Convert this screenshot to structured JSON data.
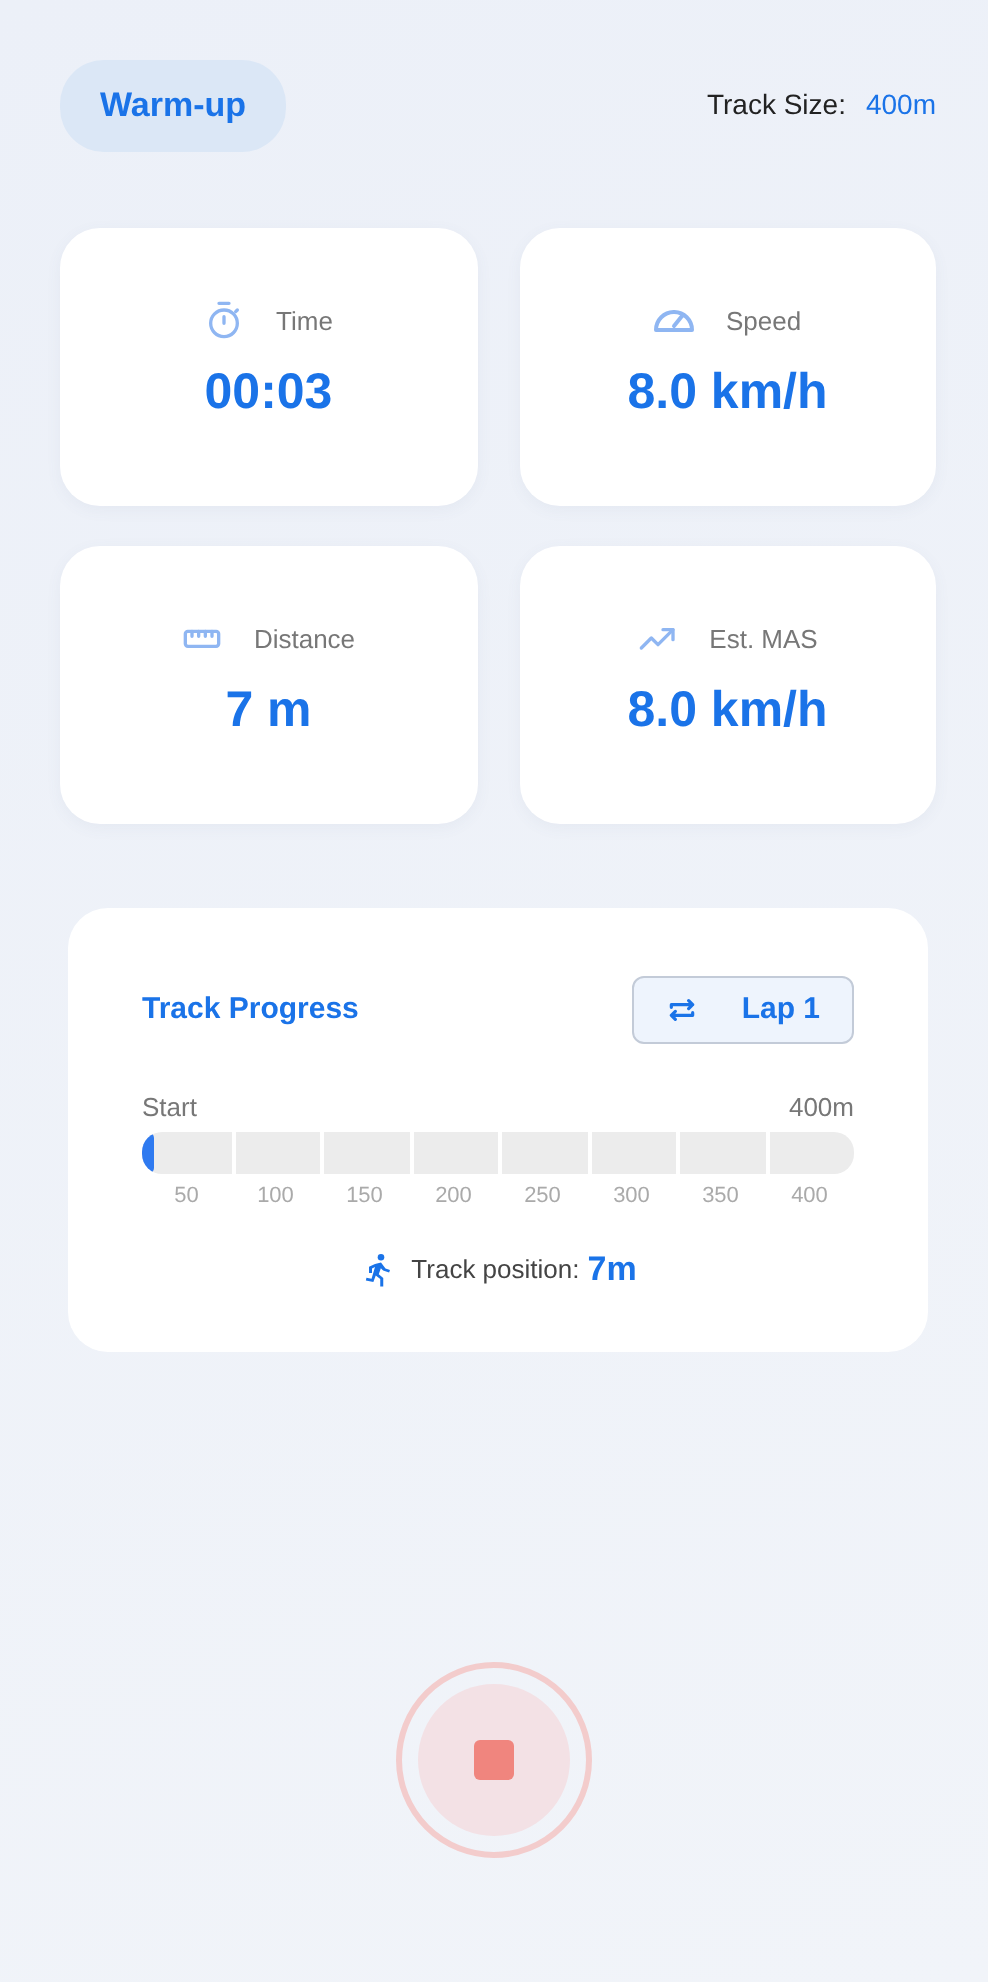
{
  "mode": {
    "label": "Warm-up"
  },
  "track_size": {
    "label": "Track Size:",
    "value": "400m"
  },
  "stats": [
    {
      "kind": "time",
      "label": "Time",
      "value": "00:03"
    },
    {
      "kind": "speed",
      "label": "Speed",
      "value": "8.0 km/h"
    },
    {
      "kind": "distance",
      "label": "Distance",
      "value": "7 m"
    },
    {
      "kind": "mas",
      "label": "Est. MAS",
      "value": "8.0 km/h"
    }
  ],
  "progress": {
    "title": "Track Progress",
    "lap": "Lap 1",
    "start_label": "Start",
    "end_label": "400m",
    "level": 0.0175,
    "ticks": [
      "50",
      "100",
      "150",
      "200",
      "250",
      "300",
      "350",
      "400"
    ],
    "position_label": "Track position:",
    "position_value": "7m"
  }
}
